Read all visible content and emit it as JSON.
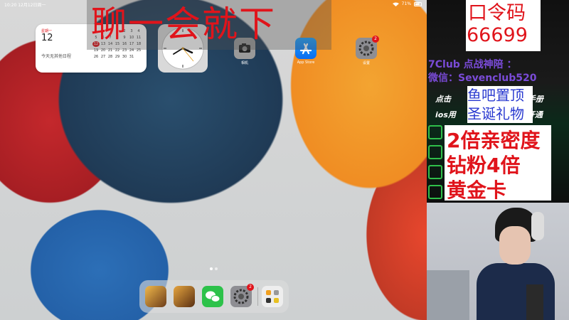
{
  "status_bar": {
    "time": "10:20",
    "date": "12月12日周一",
    "battery": "71%"
  },
  "overlay_banner": {
    "text": "聊一会就下"
  },
  "calendar_widget": {
    "weekday": "星期一",
    "day": "12",
    "note": "今天无其他日程",
    "grid": [
      "",
      "",
      "",
      "1",
      "2",
      "3",
      "4",
      "5",
      "6",
      "7",
      "8",
      "9",
      "10",
      "11",
      "12",
      "13",
      "14",
      "15",
      "16",
      "17",
      "18",
      "19",
      "20",
      "21",
      "22",
      "23",
      "24",
      "25",
      "26",
      "27",
      "28",
      "29",
      "30",
      "31",
      ""
    ],
    "today": "12"
  },
  "home_apps": [
    {
      "name": "相机",
      "icon": "camera-icon"
    },
    {
      "name": "App Store",
      "icon": "app-store-icon"
    },
    {
      "name": "设置",
      "icon": "settings-icon",
      "badge": "2"
    }
  ],
  "dock": {
    "apps": [
      {
        "icon": "game-icon"
      },
      {
        "icon": "game-icon"
      },
      {
        "icon": "wechat-icon"
      },
      {
        "icon": "settings-icon",
        "badge": "2"
      },
      {
        "icon": "app-library-icon"
      }
    ]
  },
  "promo": {
    "password_title": "口令码",
    "password_code": "66699",
    "club_line": "7Club 点战神陪 ：",
    "wechat_line": "微信：Sevenclub520",
    "hint_1": "点击",
    "hint_1_right": "手册",
    "hint_2": "ios用",
    "hint_2_right": "开通",
    "gift_1": "鱼吧置顶",
    "gift_2": "圣诞礼物",
    "bonus_1": "2倍亲密度",
    "bonus_2": "钻粉4倍",
    "bonus_3": "黄金卡"
  },
  "colors": {
    "red": "#e0141b",
    "blue_text": "#2a3ad0",
    "purple_text": "#7a4bd8",
    "wallpaper_orange": "#f08d23",
    "wallpaper_navy": "#1f3a55"
  }
}
